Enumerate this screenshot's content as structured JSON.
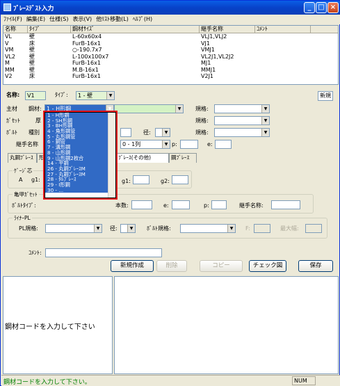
{
  "window": {
    "title": "ﾌﾞﾚｰｽﾃﾞｽﾄ入力",
    "btn_min": "_",
    "btn_max": "□",
    "btn_close": "×"
  },
  "menu": [
    "ﾌｧｲﾙ(F)",
    "編集(E)",
    "仕様(S)",
    "表示(V)",
    "他ﾘｽﾄ移動(L)",
    "ﾍﾙﾌﾟ(H)"
  ],
  "list": {
    "headers": [
      "名称",
      "ﾀｲﾌﾟ",
      "鋼材ｻｲｽﾞ",
      "継手名称",
      "ｺﾒﾝﾄ"
    ],
    "rows": [
      [
        "VL",
        "壁",
        "L-60x60x4",
        "VLJ1,VLJ2",
        ""
      ],
      [
        "V",
        "床",
        "FurB-16x1",
        "VJ1",
        ""
      ],
      [
        "VM",
        "壁",
        "○-190.7x7",
        "VMJ1",
        ""
      ],
      [
        "VL2",
        "壁",
        "L-100x100x7",
        "VL2J1,VL2J2",
        ""
      ],
      [
        "M",
        "壁",
        "FurB-16x1",
        "MJ1",
        ""
      ],
      [
        "MM",
        "壁",
        "M.B-16x1",
        "MMJ1",
        ""
      ],
      [
        "V2",
        "床",
        "FurB-16x1",
        "V2J1",
        ""
      ]
    ]
  },
  "form": {
    "name_label": "名称:",
    "name_value": "V1",
    "type_label": "ﾀｲﾌﾟ:",
    "type_value": "1 - 壁",
    "new_label": "新規",
    "main_label": "主材",
    "steel_label": "鋼材:",
    "steel_value": "1 - H形鋼",
    "spec_label": "規格:",
    "gusset_label": "ｶﾞｾｯﾄ",
    "thick_label": "厚",
    "bolt_label": "ﾎﾞﾙﾄ",
    "kind_label": "種別",
    "dia_label": "径:",
    "joint_label": "継手名称",
    "joint_combo": "0 - 1列",
    "p_label": "p:",
    "e_label": "e:"
  },
  "tabs": [
    "丸鋼ﾌﾞﾚｰｽ",
    "形",
    "ﾌﾞﾚｰｽ(その他)",
    "鋼ﾌﾞﾚｰｽ"
  ],
  "gauge": {
    "title": "ｹﾞｰｼﾞ芯",
    "a_label": "A",
    "g1_label": "g1:",
    "g1b_label": "g1:",
    "g2_label": "g2:"
  },
  "kame": {
    "title": "亀甲ｶﾞｾｯﾄ",
    "bolt_type_label": "ﾎﾞﾙﾄﾀｲﾌﾟ:",
    "count_label": "本数:",
    "e_label": "e:",
    "p_label": "p:",
    "joint_label": "継手名称:"
  },
  "liner": {
    "title": "ﾗｲﾅｰPL",
    "spec_label": "PL規格:",
    "dia_label": "径:",
    "bolt_spec_label": "ﾎﾞﾙﾄ規格:",
    "f_label": "F:",
    "max_label": "最大幅:"
  },
  "comment_label": "ｺﾒﾝﾄ:",
  "buttons": {
    "create": "新規作成",
    "delete": "削除",
    "copy": "コピー",
    "check": "チェック図",
    "save": "保存"
  },
  "message": "鋼材コードを入力して下さい",
  "status": {
    "text": "鋼材コードを入力して下さい。",
    "num": "NUM"
  },
  "dropdown": [
    "1 - H形鋼",
    "2 - SH形鋼",
    "3 - BH形鋼",
    "4 - 角形鋼管",
    "5 - 丸形鋼管",
    "6 - 鋼管",
    "7 - 溝形鋼",
    "8 - 山形鋼",
    "9 - 山形鋼2枚合",
    "14 - 平鋼",
    "26 - 丸鋼ﾌﾞﾚｰｽM",
    "27 - 丸鋼ﾌﾞﾚｰｽM",
    "28 - ﾀﾙﾌﾞﾚｰｽ",
    "29 - I形鋼",
    "30 - ..."
  ]
}
